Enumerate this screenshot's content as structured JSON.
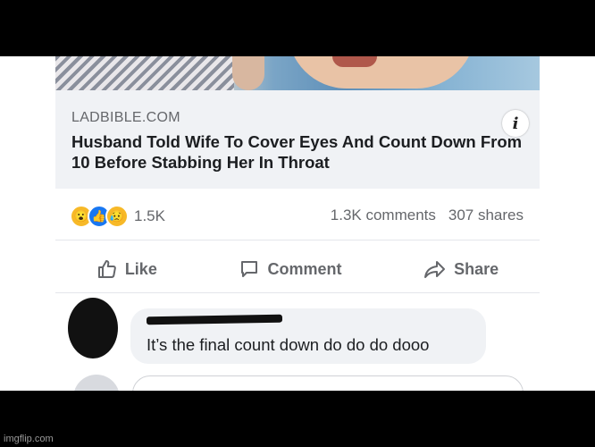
{
  "link": {
    "domain": "LADBIBLE.COM",
    "title": "Husband Told Wife To Cover Eyes And Count Down From 10 Before Stabbing Her In Throat",
    "info_icon_char": "i"
  },
  "reactions": {
    "icons": [
      "wow-icon",
      "like-icon",
      "sad-icon"
    ],
    "emoji": [
      "😮",
      "👍",
      "😥"
    ],
    "count": "1.5K"
  },
  "counts": {
    "comments": "1.3K comments",
    "shares": "307 shares"
  },
  "actions": {
    "like": "Like",
    "comment": "Comment",
    "share": "Share"
  },
  "comment": {
    "text": "It’s the final count down do do do dooo"
  },
  "watermark": "imgflip.com",
  "colors": {
    "brand_blue": "#1877f2",
    "secondary_text": "#65676b",
    "card_bg": "#f0f2f5"
  }
}
